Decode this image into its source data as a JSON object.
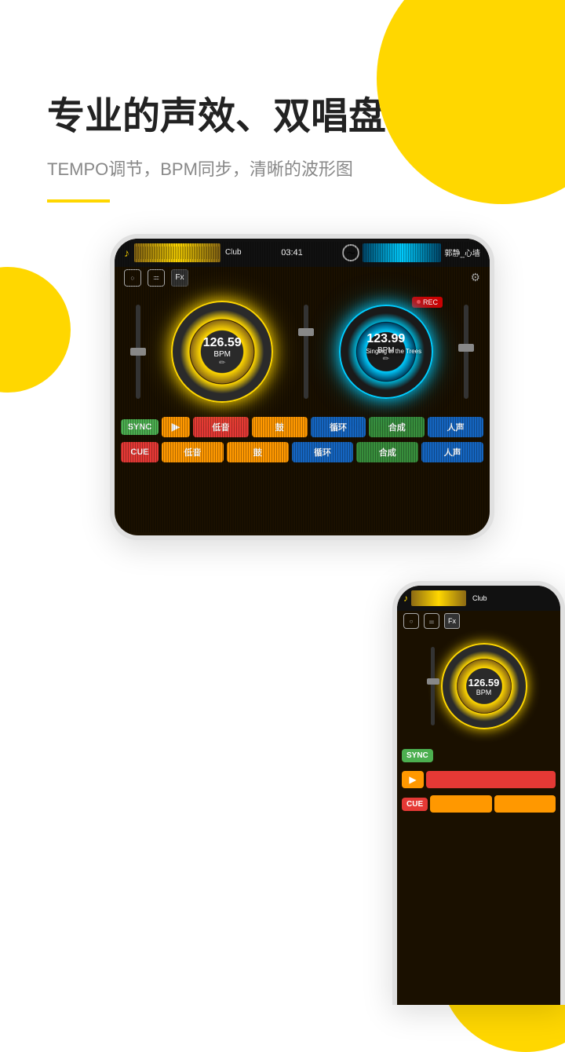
{
  "background": {
    "color": "#ffffff",
    "accent_color": "#FFD700"
  },
  "header": {
    "main_title": "专业的声效、双唱盘",
    "sub_title": "TEMPO调节，BPM同步，清晰的波形图"
  },
  "dj_app": {
    "left_track": {
      "name": "Club",
      "time": "03:41",
      "bpm": "126.59",
      "bpm_label": "BPM"
    },
    "right_track": {
      "name": "郭静_心墙",
      "bpm": "123.99",
      "bpm_label": "BPM",
      "overlay_text": "Singing\nin the\nTrees"
    },
    "controls": {
      "btn1": "○",
      "btn2": "≡",
      "btn3": "Fx",
      "gear": "⚙",
      "sync": "SYNC",
      "play": "▶",
      "rec": "REC"
    },
    "pad_row1": {
      "bass": "低音",
      "drum": "鼓",
      "loop": "循环",
      "synth": "合成",
      "vocal": "人声"
    },
    "pad_row2": {
      "cue": "CUE",
      "bass": "低音",
      "drum": "鼓",
      "loop": "循环",
      "synth": "合成",
      "vocal": "人声"
    }
  },
  "second_phone": {
    "track_name": "Club",
    "bpm": "126.59",
    "bpm_label": "BPM",
    "sync": "SYNC",
    "play": "▶",
    "cue": "CUE"
  }
}
